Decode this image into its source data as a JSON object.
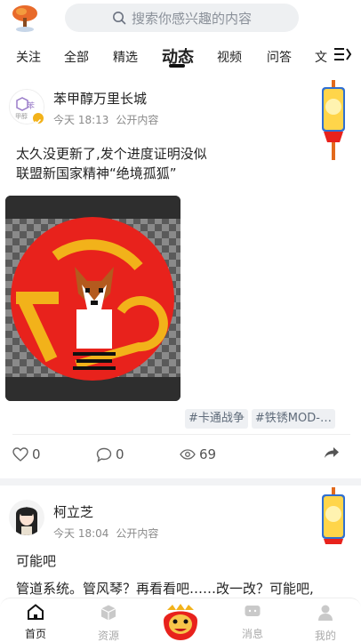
{
  "search": {
    "placeholder": "搜索你感兴趣的内容",
    "icon": "search-icon"
  },
  "tabs": [
    {
      "label": "关注"
    },
    {
      "label": "全部"
    },
    {
      "label": "精选"
    },
    {
      "label": "动态",
      "active": true
    },
    {
      "label": "视频"
    },
    {
      "label": "问答"
    },
    {
      "label": "文"
    }
  ],
  "posts": [
    {
      "username": "苯甲醇万里长城",
      "time": "今天 18:13",
      "visibility": "公开内容",
      "avatar_text": "甲醇",
      "lines": [
        "太久没更新了,发个进度证明没似",
        "联盟新国家精神“绝境孤狐”"
      ],
      "tags": [
        "#卡通战争",
        "#铁锈MOD-…"
      ],
      "likes": "0",
      "comments": "0",
      "views": "69"
    },
    {
      "username": "柯立芝",
      "time": "今天 18:04",
      "visibility": "公开内容",
      "lines": [
        "可能吧",
        "管道系统。管风琴？再看看吧……改一改？可能吧,"
      ]
    }
  ],
  "bottom_nav": [
    {
      "label": "首页",
      "active": true
    },
    {
      "label": "资源"
    },
    {
      "label": ""
    },
    {
      "label": "消息"
    },
    {
      "label": "我的"
    }
  ],
  "colors": {
    "accent": "#f2b21a",
    "flag_red": "#e8221c",
    "tag_bg": "#eef0f3"
  }
}
